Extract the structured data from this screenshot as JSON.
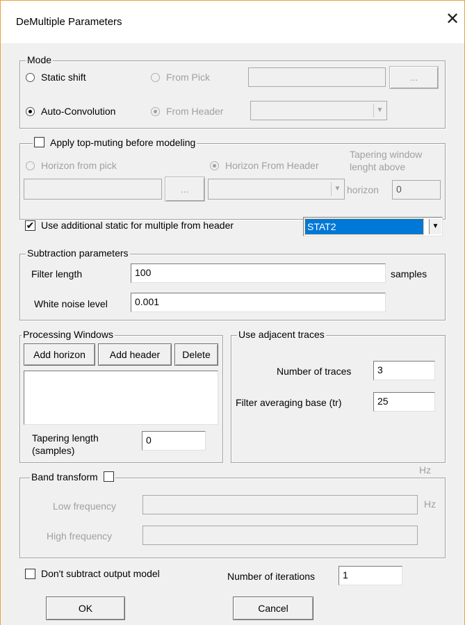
{
  "window": {
    "title": "DeMultiple Parameters",
    "close_glyph": "✕"
  },
  "mode": {
    "legend": "Mode",
    "static_shift": "Static shift",
    "from_pick": "From Pick",
    "auto_convolution": "Auto-Convolution",
    "from_header": "From Header",
    "browse_label": "..."
  },
  "muting": {
    "apply_label": "Apply top-muting before modeling",
    "horizon_from_pick": "Horizon from pick",
    "horizon_from_header": "Horizon From Header",
    "tapering_line1": "Tapering window",
    "tapering_line2": "lenght above",
    "horizon_label": "horizon",
    "tapering_value": "0",
    "browse_label": "..."
  },
  "additional_static": {
    "label": "Use additional static for multiple from header",
    "checked": "✔",
    "selected": "STAT2"
  },
  "subtraction": {
    "legend": "Subtraction parameters",
    "filter_length_label": "Filter length",
    "filter_length_value": "100",
    "samples_unit": "samples",
    "white_noise_label": "White noise level",
    "white_noise_value": "0.001"
  },
  "processing": {
    "legend": "Processing Windows",
    "add_horizon": "Add horizon",
    "add_header": "Add header",
    "delete": "Delete",
    "tapering_line1": "Tapering length",
    "tapering_line2": "(samples)",
    "tapering_value": "0"
  },
  "adjacent": {
    "legend": "Use adjacent traces",
    "num_traces_label": "Number of traces",
    "num_traces_value": "3",
    "filter_avg_label": "Filter averaging base (tr)",
    "filter_avg_value": "25"
  },
  "band": {
    "legend": "Band transform",
    "hz_top": "Hz",
    "low_label": "Low frequency",
    "hz_unit": "Hz",
    "high_label": "High frequency"
  },
  "footer": {
    "dont_subtract": "Don't subtract output model",
    "iterations_label": "Number of iterations",
    "iterations_value": "1",
    "ok": "OK",
    "cancel": "Cancel"
  },
  "colors": {
    "accent_border": "#e8a33b",
    "selection": "#0078d7"
  }
}
